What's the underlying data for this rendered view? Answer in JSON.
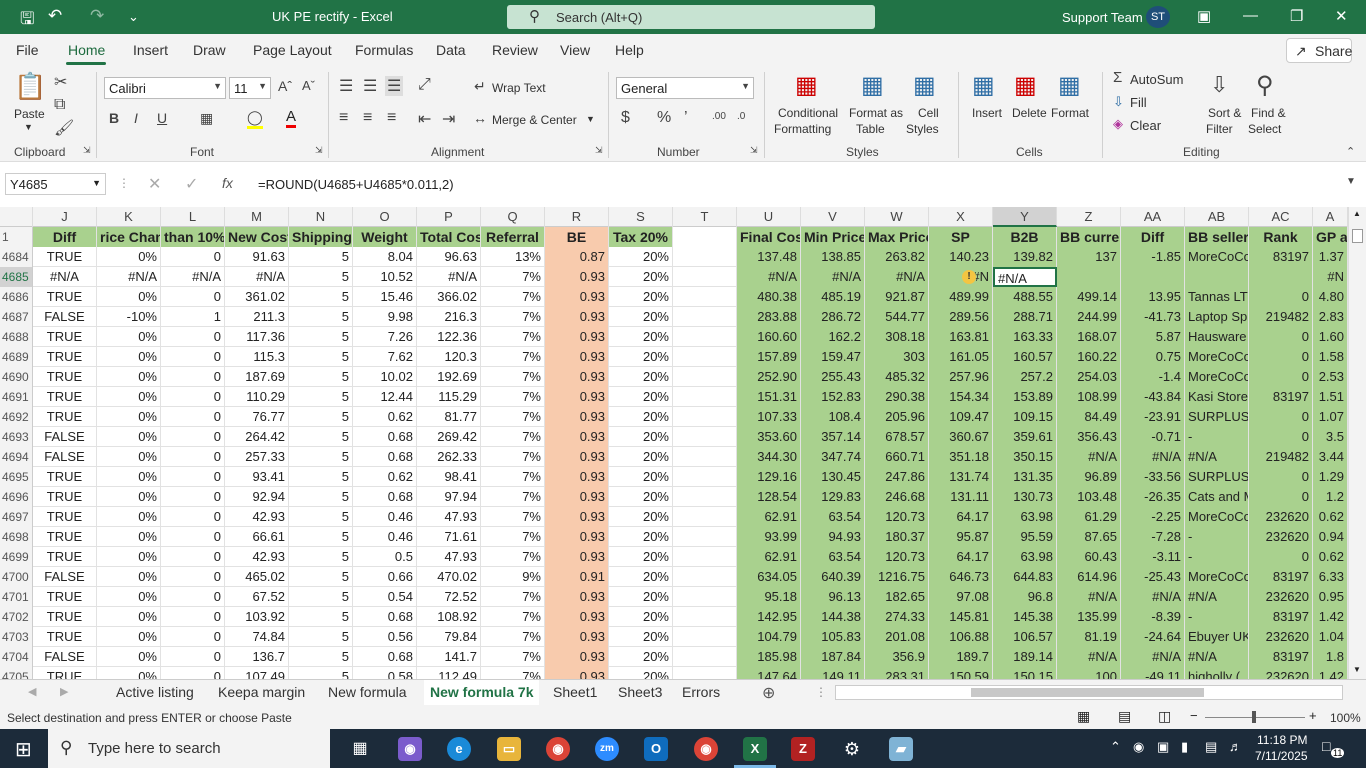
{
  "title_bar": {
    "doc_title": "UK PE rectify  -  Excel",
    "search_placeholder": "Search (Alt+Q)",
    "account_name": "Support Team",
    "avatar_initials": "ST"
  },
  "ribbon_tabs": [
    "File",
    "Home",
    "Insert",
    "Draw",
    "Page Layout",
    "Formulas",
    "Data",
    "Review",
    "View",
    "Help"
  ],
  "share_label": "Share",
  "ribbon": {
    "clipboard": {
      "paste": "Paste",
      "group": "Clipboard"
    },
    "font": {
      "name": "Calibri",
      "size": "11",
      "group": "Font"
    },
    "alignment": {
      "wrap": "Wrap Text",
      "merge": "Merge & Center",
      "group": "Alignment"
    },
    "number": {
      "format": "General",
      "group": "Number"
    },
    "styles": {
      "cond1": "Conditional",
      "cond2": "Formatting",
      "fmt1": "Format as",
      "fmt2": "Table",
      "cell1": "Cell",
      "cell2": "Styles",
      "group": "Styles"
    },
    "cells": {
      "insert": "Insert",
      "delete": "Delete",
      "format": "Format",
      "group": "Cells"
    },
    "editing": {
      "autosum": "AutoSum",
      "fill": "Fill",
      "clear": "Clear",
      "sort1": "Sort &",
      "sort2": "Filter",
      "find1": "Find &",
      "find2": "Select",
      "group": "Editing"
    }
  },
  "formula_bar": {
    "name_box": "Y4685",
    "formula": "=ROUND(U4685+U4685*0.011,2)"
  },
  "columns": [
    "J",
    "K",
    "L",
    "M",
    "N",
    "O",
    "P",
    "Q",
    "R",
    "S",
    "T",
    "U",
    "V",
    "W",
    "X",
    "Y",
    "Z",
    "AA",
    "AB",
    "AC",
    "A"
  ],
  "header_row": {
    "num": "1",
    "cells": [
      "Diff",
      "rice Chang",
      "than 10%",
      "New Cost",
      "Shipping",
      "Weight",
      "Total Cost",
      "Referral",
      "BE",
      "Tax 20%",
      "",
      "Final Cost",
      "Min Price",
      "Max Price",
      "SP",
      "B2B",
      "BB current",
      "Diff",
      "BB seller",
      "Rank",
      "GP a"
    ]
  },
  "rows": [
    {
      "num": "4684",
      "cells": [
        "TRUE",
        "0%",
        "0",
        "91.63",
        "5",
        "8.04",
        "96.63",
        "13%",
        "0.87",
        "20%",
        "",
        "137.48",
        "138.85",
        "263.82",
        "140.23",
        "139.82",
        "137",
        "-1.85",
        "MoreCoCo",
        "83197",
        "1.37"
      ]
    },
    {
      "num": "4685",
      "cells": [
        "#N/A",
        "#N/A",
        "#N/A",
        "#N/A",
        "5",
        "10.52",
        "#N/A",
        "7%",
        "0.93",
        "20%",
        "",
        "#N/A",
        "#N/A",
        "#N/A",
        "#N",
        "#N/A",
        "",
        "",
        "",
        "",
        "#N"
      ]
    },
    {
      "num": "4686",
      "cells": [
        "TRUE",
        "0%",
        "0",
        "361.02",
        "5",
        "15.46",
        "366.02",
        "7%",
        "0.93",
        "20%",
        "",
        "480.38",
        "485.19",
        "921.87",
        "489.99",
        "488.55",
        "499.14",
        "13.95",
        "Tannas LTI",
        "0",
        "4.80"
      ]
    },
    {
      "num": "4687",
      "cells": [
        "FALSE",
        "-10%",
        "1",
        "211.3",
        "5",
        "9.98",
        "216.3",
        "7%",
        "0.93",
        "20%",
        "",
        "283.88",
        "286.72",
        "544.77",
        "289.56",
        "288.71",
        "244.99",
        "-41.73",
        "Laptop Sp",
        "219482",
        "2.83"
      ]
    },
    {
      "num": "4688",
      "cells": [
        "TRUE",
        "0%",
        "0",
        "117.36",
        "5",
        "7.26",
        "122.36",
        "7%",
        "0.93",
        "20%",
        "",
        "160.60",
        "162.2",
        "308.18",
        "163.81",
        "163.33",
        "168.07",
        "5.87",
        "Hausware",
        "0",
        "1.60"
      ]
    },
    {
      "num": "4689",
      "cells": [
        "TRUE",
        "0%",
        "0",
        "115.3",
        "5",
        "7.62",
        "120.3",
        "7%",
        "0.93",
        "20%",
        "",
        "157.89",
        "159.47",
        "303",
        "161.05",
        "160.57",
        "160.22",
        "0.75",
        "MoreCoCo",
        "0",
        "1.58"
      ]
    },
    {
      "num": "4690",
      "cells": [
        "TRUE",
        "0%",
        "0",
        "187.69",
        "5",
        "10.02",
        "192.69",
        "7%",
        "0.93",
        "20%",
        "",
        "252.90",
        "255.43",
        "485.32",
        "257.96",
        "257.2",
        "254.03",
        "-1.4",
        "MoreCoCo",
        "0",
        "2.53"
      ]
    },
    {
      "num": "4691",
      "cells": [
        "TRUE",
        "0%",
        "0",
        "110.29",
        "5",
        "12.44",
        "115.29",
        "7%",
        "0.93",
        "20%",
        "",
        "151.31",
        "152.83",
        "290.38",
        "154.34",
        "153.89",
        "108.99",
        "-43.84",
        "Kasi Store",
        "83197",
        "1.51"
      ]
    },
    {
      "num": "4692",
      "cells": [
        "TRUE",
        "0%",
        "0",
        "76.77",
        "5",
        "0.62",
        "81.77",
        "7%",
        "0.93",
        "20%",
        "",
        "107.33",
        "108.4",
        "205.96",
        "109.47",
        "109.15",
        "84.49",
        "-23.91",
        "SURPLUSD",
        "0",
        "1.07"
      ]
    },
    {
      "num": "4693",
      "cells": [
        "FALSE",
        "0%",
        "0",
        "264.42",
        "5",
        "0.68",
        "269.42",
        "7%",
        "0.93",
        "20%",
        "",
        "353.60",
        "357.14",
        "678.57",
        "360.67",
        "359.61",
        "356.43",
        "-0.71",
        "-",
        "0",
        "3.5"
      ]
    },
    {
      "num": "4694",
      "cells": [
        "FALSE",
        "0%",
        "0",
        "257.33",
        "5",
        "0.68",
        "262.33",
        "7%",
        "0.93",
        "20%",
        "",
        "344.30",
        "347.74",
        "660.71",
        "351.18",
        "350.15",
        "#N/A",
        "#N/A",
        "#N/A",
        "219482",
        "3.44"
      ]
    },
    {
      "num": "4695",
      "cells": [
        "TRUE",
        "0%",
        "0",
        "93.41",
        "5",
        "0.62",
        "98.41",
        "7%",
        "0.93",
        "20%",
        "",
        "129.16",
        "130.45",
        "247.86",
        "131.74",
        "131.35",
        "96.89",
        "-33.56",
        "SURPLUSD",
        "0",
        "1.29"
      ]
    },
    {
      "num": "4696",
      "cells": [
        "TRUE",
        "0%",
        "0",
        "92.94",
        "5",
        "0.68",
        "97.94",
        "7%",
        "0.93",
        "20%",
        "",
        "128.54",
        "129.83",
        "246.68",
        "131.11",
        "130.73",
        "103.48",
        "-26.35",
        "Cats and M",
        "0",
        "1.2"
      ]
    },
    {
      "num": "4697",
      "cells": [
        "TRUE",
        "0%",
        "0",
        "42.93",
        "5",
        "0.46",
        "47.93",
        "7%",
        "0.93",
        "20%",
        "",
        "62.91",
        "63.54",
        "120.73",
        "64.17",
        "63.98",
        "61.29",
        "-2.25",
        "MoreCoCo",
        "232620",
        "0.62"
      ]
    },
    {
      "num": "4698",
      "cells": [
        "TRUE",
        "0%",
        "0",
        "66.61",
        "5",
        "0.46",
        "71.61",
        "7%",
        "0.93",
        "20%",
        "",
        "93.99",
        "94.93",
        "180.37",
        "95.87",
        "95.59",
        "87.65",
        "-7.28",
        "-",
        "232620",
        "0.94"
      ]
    },
    {
      "num": "4699",
      "cells": [
        "TRUE",
        "0%",
        "0",
        "42.93",
        "5",
        "0.5",
        "47.93",
        "7%",
        "0.93",
        "20%",
        "",
        "62.91",
        "63.54",
        "120.73",
        "64.17",
        "63.98",
        "60.43",
        "-3.11",
        "-",
        "0",
        "0.62"
      ]
    },
    {
      "num": "4700",
      "cells": [
        "FALSE",
        "0%",
        "0",
        "465.02",
        "5",
        "0.66",
        "470.02",
        "9%",
        "0.91",
        "20%",
        "",
        "634.05",
        "640.39",
        "1216.75",
        "646.73",
        "644.83",
        "614.96",
        "-25.43",
        "MoreCoCo",
        "83197",
        "6.33"
      ]
    },
    {
      "num": "4701",
      "cells": [
        "TRUE",
        "0%",
        "0",
        "67.52",
        "5",
        "0.54",
        "72.52",
        "7%",
        "0.93",
        "20%",
        "",
        "95.18",
        "96.13",
        "182.65",
        "97.08",
        "96.8",
        "#N/A",
        "#N/A",
        "#N/A",
        "232620",
        "0.95"
      ]
    },
    {
      "num": "4702",
      "cells": [
        "TRUE",
        "0%",
        "0",
        "103.92",
        "5",
        "0.68",
        "108.92",
        "7%",
        "0.93",
        "20%",
        "",
        "142.95",
        "144.38",
        "274.33",
        "145.81",
        "145.38",
        "135.99",
        "-8.39",
        "-",
        "83197",
        "1.42"
      ]
    },
    {
      "num": "4703",
      "cells": [
        "TRUE",
        "0%",
        "0",
        "74.84",
        "5",
        "0.56",
        "79.84",
        "7%",
        "0.93",
        "20%",
        "",
        "104.79",
        "105.83",
        "201.08",
        "106.88",
        "106.57",
        "81.19",
        "-24.64",
        "Ebuyer UK",
        "232620",
        "1.04"
      ]
    },
    {
      "num": "4704",
      "cells": [
        "FALSE",
        "0%",
        "0",
        "136.7",
        "5",
        "0.68",
        "141.7",
        "7%",
        "0.93",
        "20%",
        "",
        "185.98",
        "187.84",
        "356.9",
        "189.7",
        "189.14",
        "#N/A",
        "#N/A",
        "#N/A",
        "83197",
        "1.8"
      ]
    },
    {
      "num": "4705",
      "cells": [
        "TRUE",
        "0%",
        "0",
        "107.49",
        "5",
        "0.58",
        "112.49",
        "7%",
        "0.93",
        "20%",
        "",
        "147.64",
        "149.11",
        "283.31",
        "150.59",
        "150.15",
        "100",
        "-49.11",
        "higholly (",
        "232620",
        "1.42"
      ]
    }
  ],
  "sheet_tabs": [
    "Active listing",
    "Keepa margin",
    "New formula",
    "New formula 7k",
    "Sheet1",
    "Sheet3",
    "Errors"
  ],
  "active_sheet": "New formula 7k",
  "status_text": "Select destination and press ENTER or choose Paste",
  "zoom": "100%",
  "taskbar": {
    "search_placeholder": "Type here to search",
    "time": "11:18 PM",
    "date": "7/11/2025",
    "notif_count": "11"
  },
  "colors": {
    "excel_green": "#217346",
    "header_green": "#a9d18e",
    "be_orange": "#f8cbad"
  }
}
